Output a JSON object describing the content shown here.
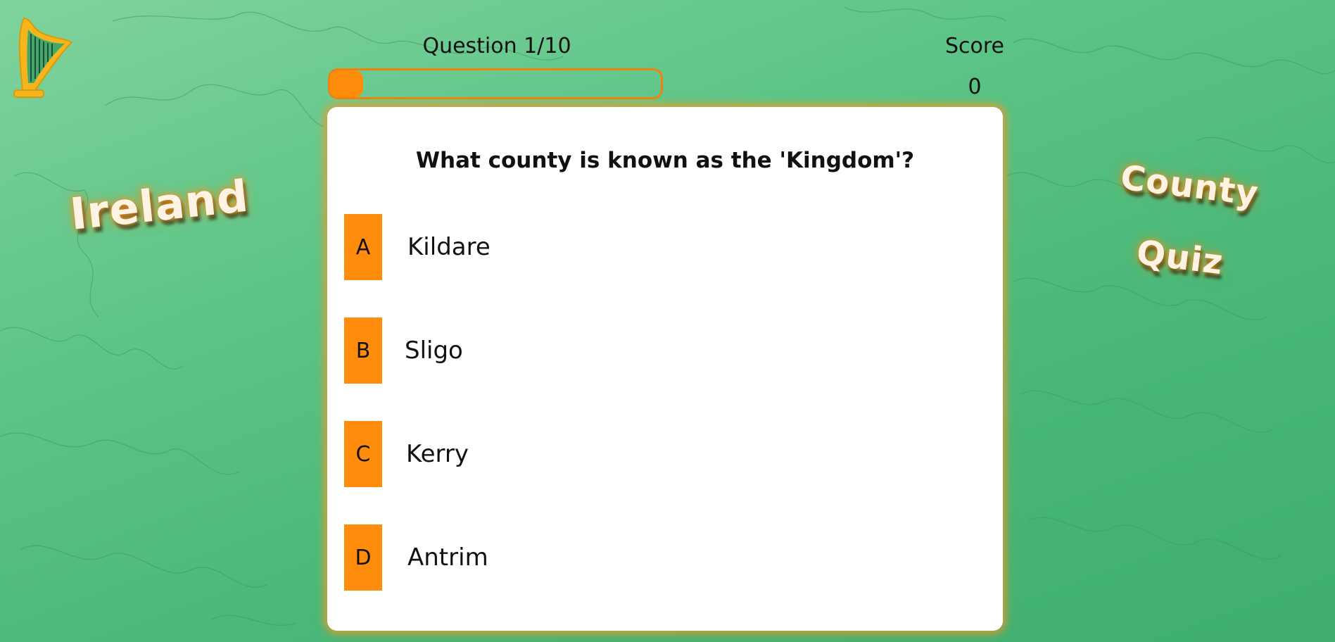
{
  "colors": {
    "accent": "#ff8c0a",
    "background": "#4fbb7c",
    "card": "#ffffff"
  },
  "decor": {
    "left_title": "Ireland",
    "right_title_line1": "County",
    "right_title_line2": "Quiz",
    "logo_icon": "harp-icon"
  },
  "header": {
    "question_counter": "Question 1/10",
    "score_label": "Score",
    "score_value": "0",
    "progress": 0.1
  },
  "quiz": {
    "question": "What county is known as the 'Kingdom'?",
    "choices": [
      {
        "letter": "A",
        "text": "Kildare"
      },
      {
        "letter": "B",
        "text": "Sligo"
      },
      {
        "letter": "C",
        "text": "Kerry"
      },
      {
        "letter": "D",
        "text": "Antrim"
      }
    ]
  }
}
